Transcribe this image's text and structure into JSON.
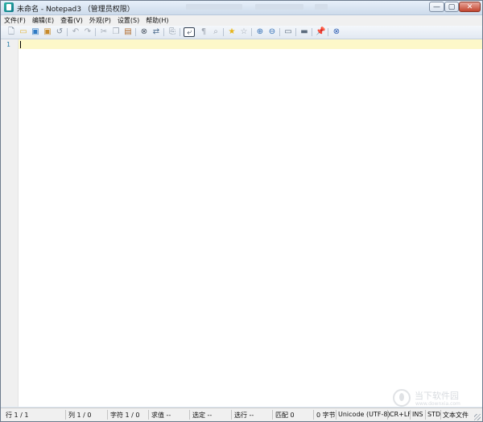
{
  "window": {
    "title": "未命名 - Notepad3 （管理员权限）",
    "controls": {
      "minimize": "—",
      "maximize": "▢",
      "close": "✕"
    }
  },
  "menu": {
    "items": [
      {
        "label": "文件(F)"
      },
      {
        "label": "编辑(E)"
      },
      {
        "label": "查看(V)"
      },
      {
        "label": "外观(P)"
      },
      {
        "label": "设置(S)"
      },
      {
        "label": "帮助(H)"
      }
    ]
  },
  "toolbar": {
    "buttons": [
      {
        "icon": "new-file-icon",
        "glyph": "🗋",
        "color": "#6b7a8c"
      },
      {
        "icon": "open-folder-icon",
        "glyph": "▭",
        "color": "#e0b437"
      },
      {
        "icon": "save-icon",
        "glyph": "▣",
        "color": "#2f7bc4"
      },
      {
        "icon": "save-as-icon",
        "glyph": "▣",
        "color": "#c88a2a"
      },
      {
        "icon": "revert-icon",
        "glyph": "↺",
        "color": "#7d8a99"
      },
      {
        "icon": "undo-icon",
        "glyph": "↶",
        "color": "#a0a8b3"
      },
      {
        "icon": "redo-icon",
        "glyph": "↷",
        "color": "#a0a8b3"
      },
      {
        "icon": "cut-icon",
        "glyph": "✂",
        "color": "#a0a8b3"
      },
      {
        "icon": "copy-icon",
        "glyph": "❐",
        "color": "#a0a8b3"
      },
      {
        "icon": "paste-icon",
        "glyph": "▤",
        "color": "#b06a2a"
      },
      {
        "icon": "find-icon",
        "glyph": "⊗",
        "color": "#4b5563"
      },
      {
        "icon": "replace-icon",
        "glyph": "⇄",
        "color": "#4b6a8c"
      },
      {
        "icon": "goto-icon",
        "glyph": "⎘",
        "color": "#7d8a99"
      },
      {
        "icon": "word-wrap-icon",
        "glyph": "⤶",
        "color": "#2f3d4f"
      },
      {
        "icon": "whitespace-icon",
        "glyph": "¶",
        "color": "#a0a8b3"
      },
      {
        "icon": "line-endings-icon",
        "glyph": "⌕",
        "color": "#a0a8b3"
      },
      {
        "icon": "favorite-star-icon",
        "glyph": "★",
        "color": "#e7b416"
      },
      {
        "icon": "add-favorite-icon",
        "glyph": "☆",
        "color": "#a0a8b3"
      },
      {
        "icon": "zoom-in-icon",
        "glyph": "⊕",
        "color": "#2f6db5"
      },
      {
        "icon": "zoom-out-icon",
        "glyph": "⊖",
        "color": "#2f6db5"
      },
      {
        "icon": "scheme-icon",
        "glyph": "▭",
        "color": "#5b6b7d"
      },
      {
        "icon": "settings-icon",
        "glyph": "▬",
        "color": "#5b6b7d"
      },
      {
        "icon": "pin-icon",
        "glyph": "📌",
        "color": "#2f6db5"
      },
      {
        "icon": "exit-icon",
        "glyph": "⊗",
        "color": "#2f5fb5"
      }
    ]
  },
  "editor": {
    "line_number": "1",
    "current_line_color": "#fdf8c9"
  },
  "status": {
    "line": "行 1 / 1",
    "column": "列 1 / 0",
    "chars": "字符 1 / 0",
    "sum": "求值 --",
    "selection": "选定 --",
    "sel_lines": "选行 --",
    "matches": "匹配 0",
    "bytes": "0 字节",
    "encoding": "Unicode (UTF-8)",
    "eol": "CR+LF",
    "ins": "INS",
    "std": "STD",
    "type": "文本文件"
  },
  "watermark": {
    "name": "当下软件园",
    "url": "www.downxia.com"
  }
}
